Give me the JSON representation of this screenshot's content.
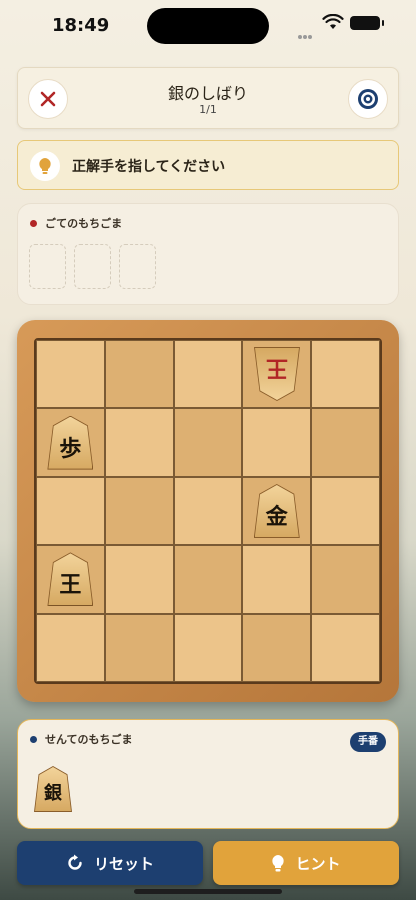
{
  "status_bar": {
    "time": "18:49"
  },
  "header": {
    "title": "銀のしばり",
    "progress": "1/1"
  },
  "prompt": {
    "text": "正解手を指してください"
  },
  "gote_hand": {
    "label": "ごてのもちごま",
    "dot_color": "#b12626",
    "pieces": []
  },
  "board": {
    "rows": 5,
    "cols": 5,
    "pieces": [
      {
        "row": 0,
        "col": 3,
        "char": "王",
        "owner": "gote"
      },
      {
        "row": 1,
        "col": 0,
        "char": "歩",
        "owner": "sente"
      },
      {
        "row": 2,
        "col": 3,
        "char": "金",
        "owner": "sente"
      },
      {
        "row": 3,
        "col": 0,
        "char": "王",
        "owner": "sente"
      }
    ]
  },
  "sente_hand": {
    "label": "せんてのもちごま",
    "dot_color": "#1d3f70",
    "turn_badge": "手番",
    "pieces": [
      "銀"
    ]
  },
  "buttons": {
    "reset": "リセット",
    "hint": "ヒント"
  },
  "colors": {
    "navy": "#1d3f70",
    "gold": "#e1a33b",
    "red": "#b12626"
  }
}
